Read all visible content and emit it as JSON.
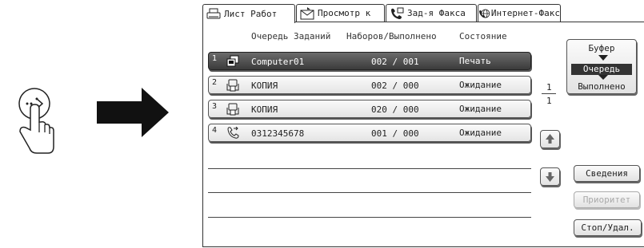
{
  "tabs": [
    {
      "label": "Лист Работ",
      "icon": "printer-icon",
      "active": true
    },
    {
      "label": "Просмотр к",
      "icon": "scan-icon",
      "active": false
    },
    {
      "label": "Зад-я Факса",
      "icon": "fax-icon",
      "active": false
    },
    {
      "label": "Интернет-Факс",
      "icon": "internet-fax-icon",
      "active": false
    }
  ],
  "headers": {
    "queue": "Очередь Заданий",
    "sets": "Наборов/Выполнено",
    "status": "Состояние"
  },
  "jobs": [
    {
      "num": "1",
      "icon": "computer-icon",
      "name": "Computer01",
      "count": "002 / 001",
      "status": "Печать",
      "selected": true
    },
    {
      "num": "2",
      "icon": "copy-icon",
      "name": "КОПИЯ",
      "count": "002 / 000",
      "status": "Ожидание",
      "selected": false
    },
    {
      "num": "3",
      "icon": "copy-icon",
      "name": "КОПИЯ",
      "count": "020 / 000",
      "status": "Ожидание",
      "selected": false
    },
    {
      "num": "4",
      "icon": "fax-send-icon",
      "name": "0312345678",
      "count": "001 / 000",
      "status": "Ожидание",
      "selected": false
    }
  ],
  "mode": {
    "top": "Буфер",
    "middle": "Очередь",
    "bottom": "Выполнено"
  },
  "page": {
    "current": "1",
    "total": "1"
  },
  "buttons": {
    "details": "Сведения",
    "priority": "Приоритет",
    "stop": "Стоп/Удал."
  },
  "colors": {
    "selected_row": "#4a4a4a",
    "disabled_text": "#aaaaaa"
  }
}
